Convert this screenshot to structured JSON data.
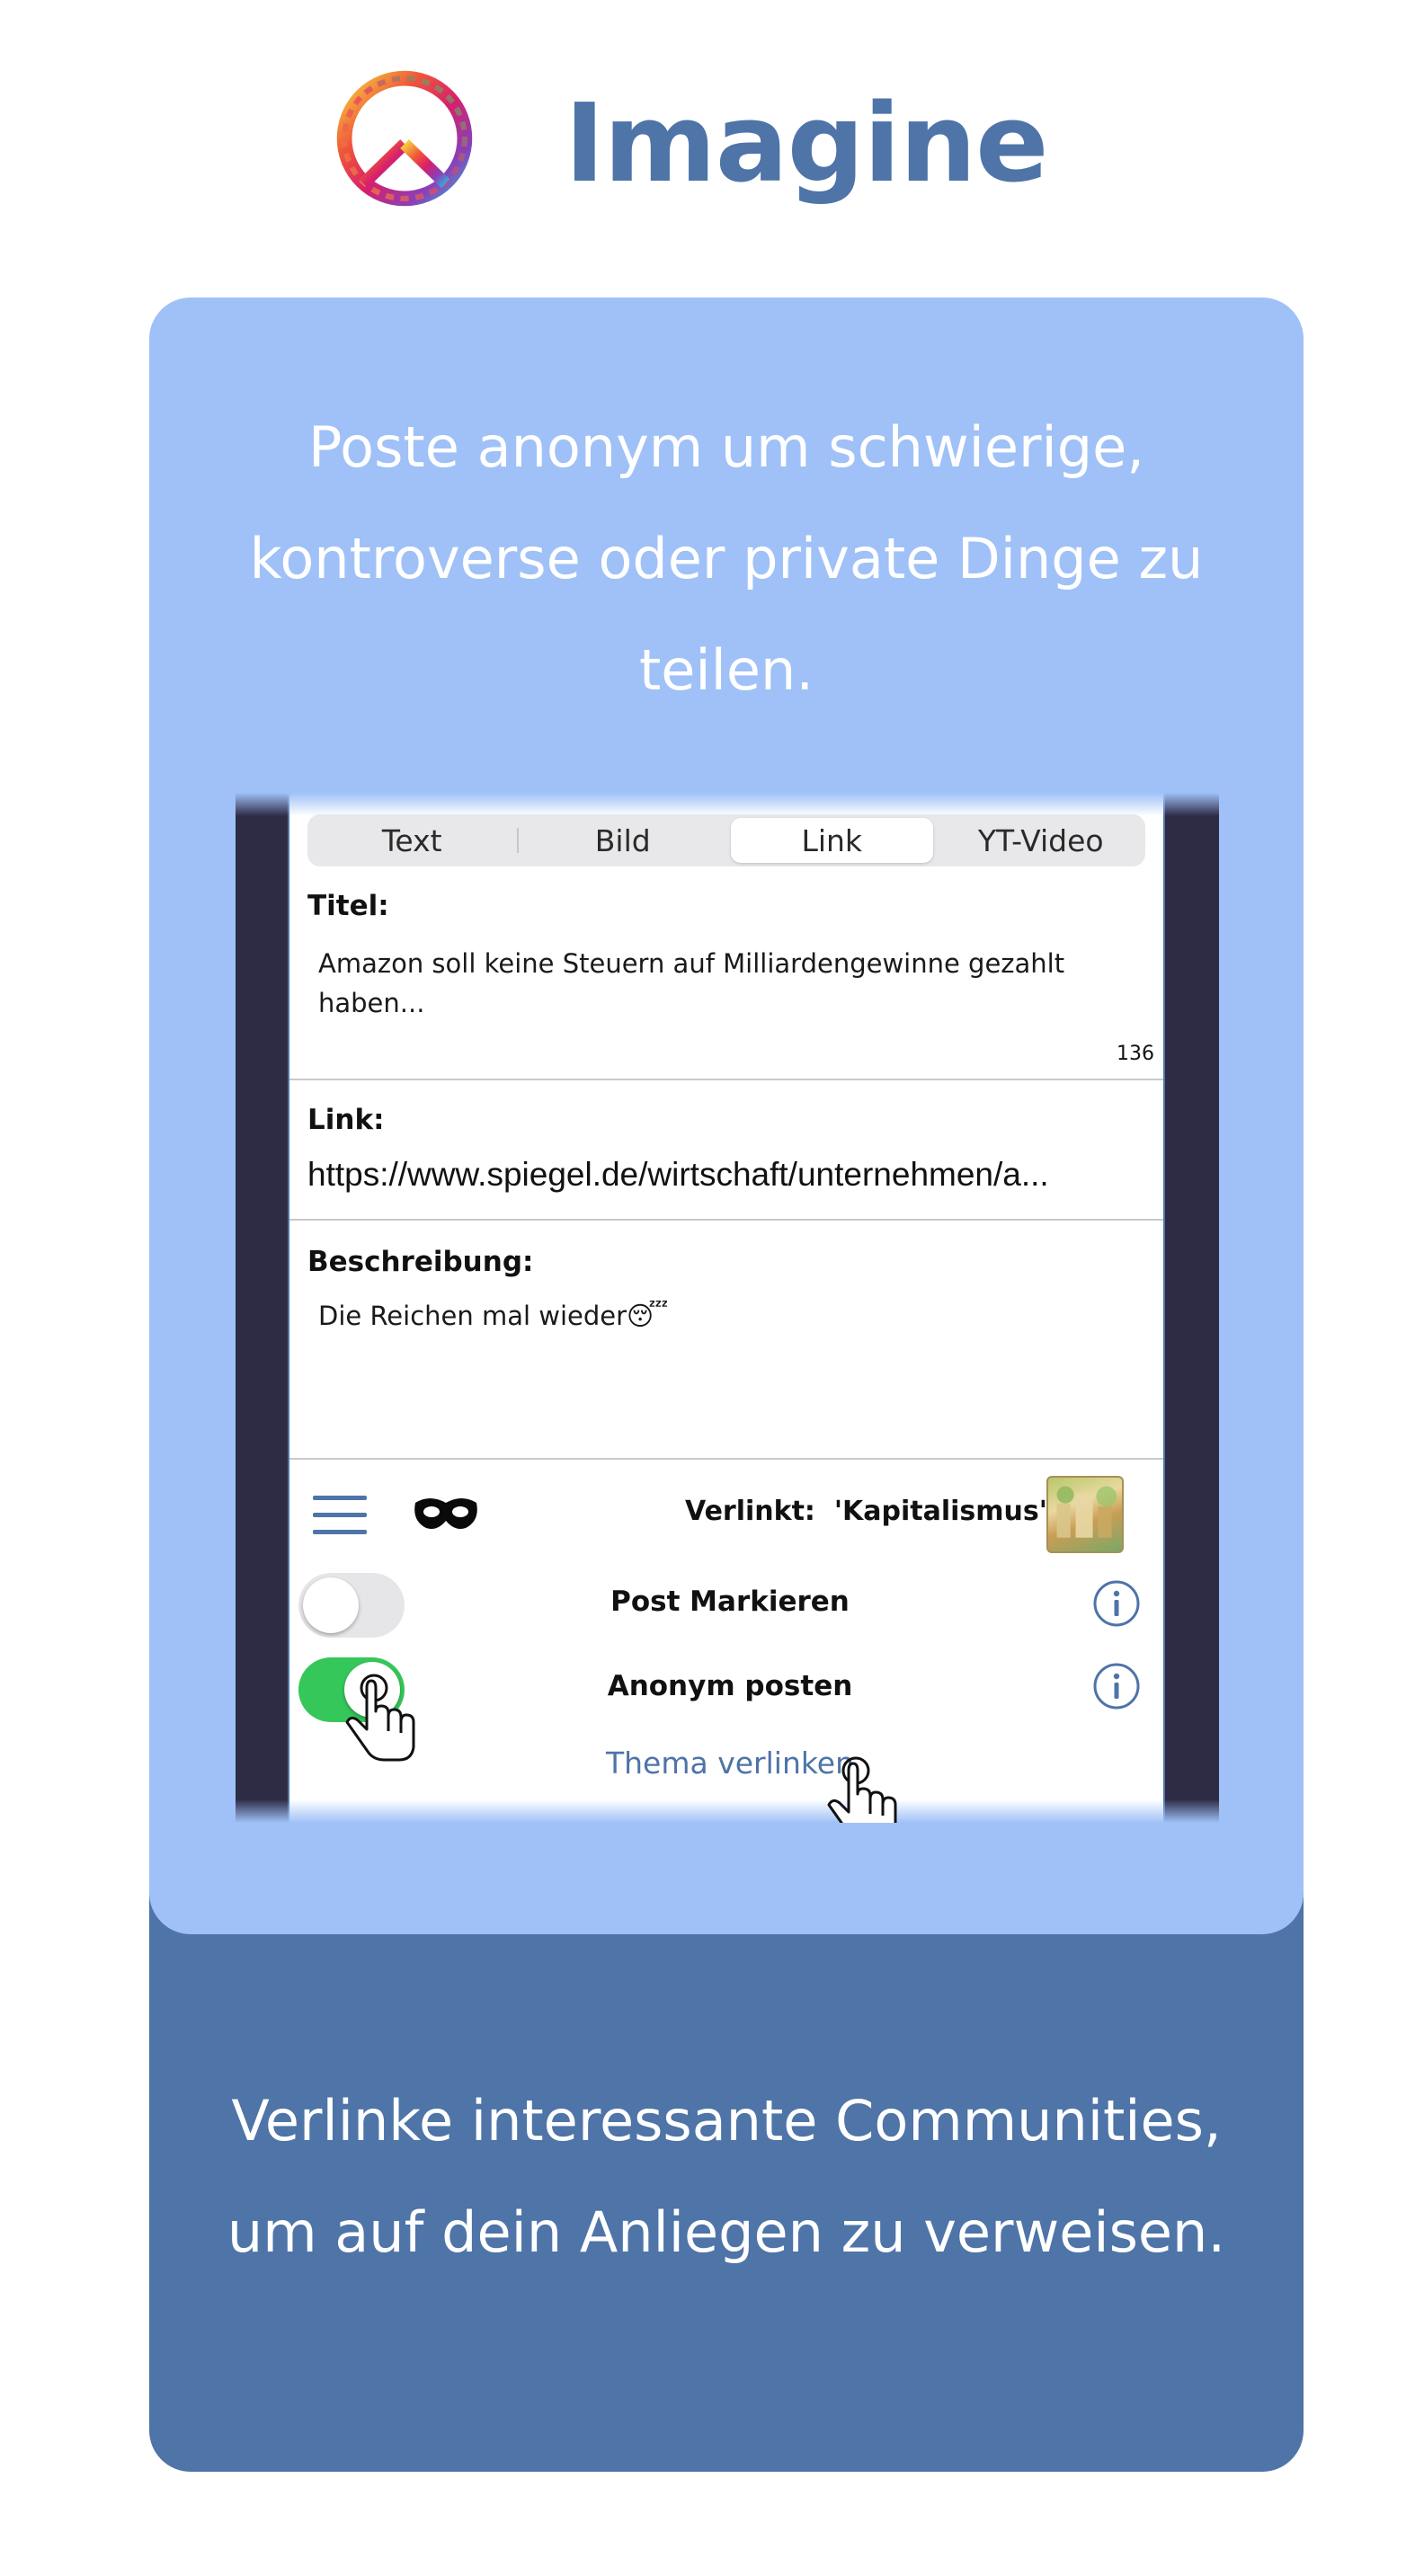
{
  "app": {
    "title": "Imagine"
  },
  "intro": {
    "line1": "Poste anonym um schwierige,",
    "line2": "kontroverse oder private Dinge zu",
    "line3": "teilen."
  },
  "outro": {
    "line1": "Verlinke interessante Communities,",
    "line2": "um auf dein Anliegen zu verweisen."
  },
  "post_editor": {
    "tabs": [
      {
        "label": "Text",
        "active": false
      },
      {
        "label": "Bild",
        "active": false
      },
      {
        "label": "Link",
        "active": true
      },
      {
        "label": "YT-Video",
        "active": false
      }
    ],
    "title_label": "Titel:",
    "title_value_line1": "Amazon soll keine Steuern auf Milliardengewinne gezahlt",
    "title_value_line2": "haben...",
    "title_char_count": "136",
    "link_label": "Link:",
    "link_value": "https://www.spiegel.de/wirtschaft/unternehmen/a...",
    "description_label": "Beschreibung:",
    "description_value": "Die Reichen mal wieder",
    "description_emoji": "😴",
    "toolbar": {
      "linked_label": "Verlinkt:  'Kapitalismus'"
    },
    "options": [
      {
        "label": "Post Markieren",
        "enabled": false
      },
      {
        "label": "Anonym posten",
        "enabled": true
      }
    ],
    "link_topic_button": "Thema verlinken"
  },
  "colors": {
    "brand_blue": "#4e74a8",
    "card_light": "#9fc1f7",
    "toggle_on": "#35c759",
    "frame_dark": "#2e2b45"
  },
  "icons": [
    "peace-logo-icon",
    "hamburger-menu-icon",
    "anonymous-mask-icon",
    "info-icon",
    "hand-pointer-icon"
  ]
}
